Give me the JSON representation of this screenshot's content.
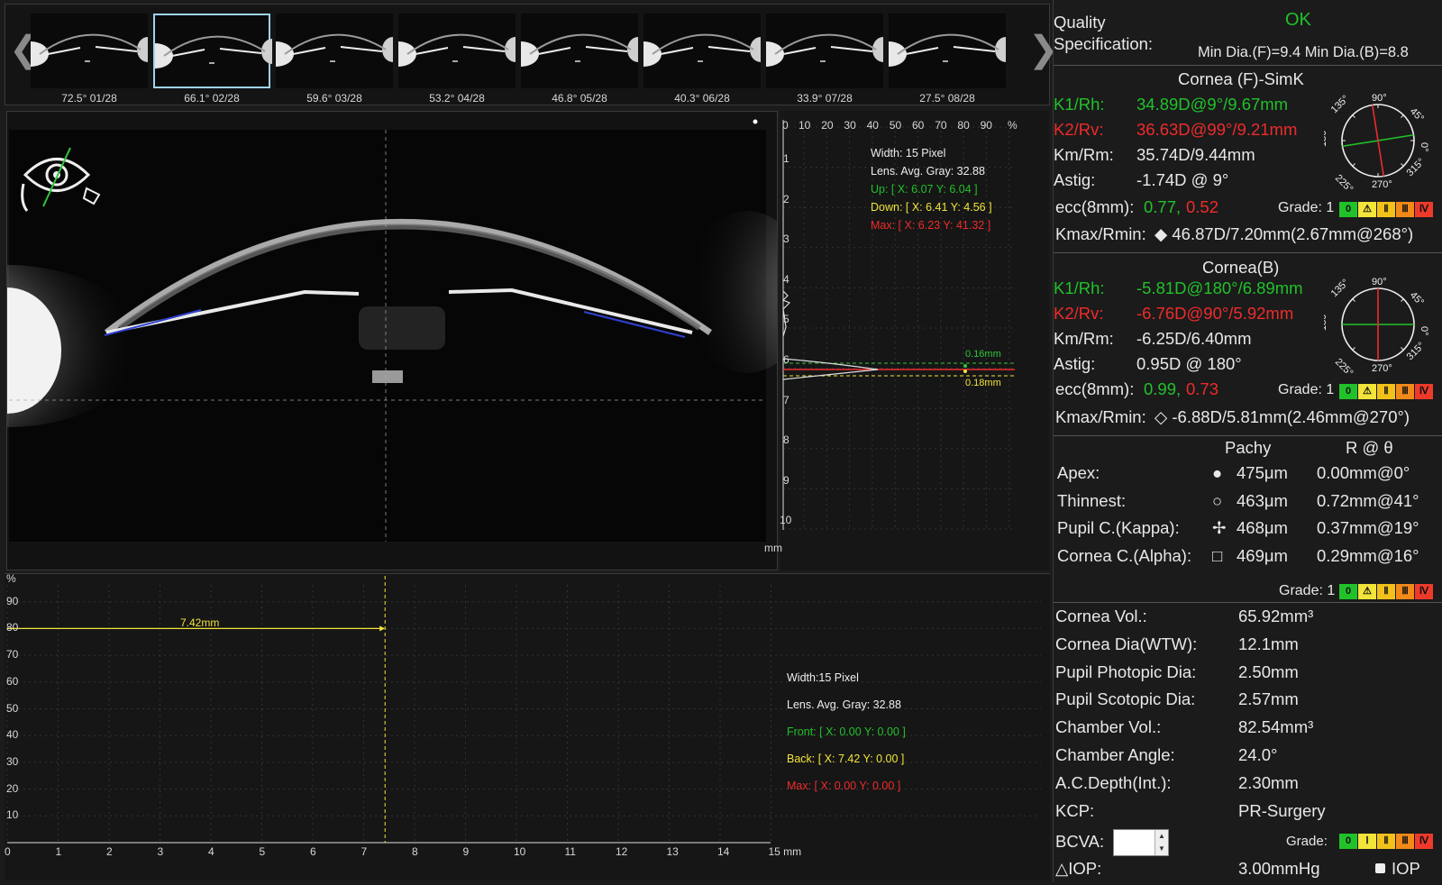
{
  "thumbnails": [
    {
      "angle": "72.5°",
      "index": "01/28"
    },
    {
      "angle": "66.1°",
      "index": "02/28"
    },
    {
      "angle": "59.6°",
      "index": "03/28"
    },
    {
      "angle": "53.2°",
      "index": "04/28"
    },
    {
      "angle": "46.8°",
      "index": "05/28"
    },
    {
      "angle": "40.3°",
      "index": "06/28"
    },
    {
      "angle": "33.9°",
      "index": "07/28"
    },
    {
      "angle": "27.5°",
      "index": "08/28"
    }
  ],
  "nav": {
    "prev": "❮",
    "next": "❯"
  },
  "profile": {
    "x_ticks": [
      "0",
      "10",
      "20",
      "30",
      "40",
      "50",
      "60",
      "70",
      "80",
      "90",
      "%"
    ],
    "y_ticks": [
      "1",
      "2",
      "3",
      "4",
      "5",
      "6",
      "7",
      "8",
      "9",
      "10"
    ],
    "y_unit": "mm",
    "width": "Width: 15 Pixel",
    "avg_gray": "Lens. Avg. Gray: 32.88",
    "up": "Up: [ X: 6.07  Y: 6.04 ]",
    "down": "Down: [ X: 6.41  Y: 4.56 ]",
    "max": "Max: [ X: 6.23  Y: 41.32 ]",
    "label_top": "0.16mm",
    "label_bottom": "0.18mm"
  },
  "graph": {
    "y_unit": "%",
    "y_ticks": [
      "90",
      "80",
      "70",
      "60",
      "50",
      "40",
      "30",
      "20",
      "10"
    ],
    "x_ticks": [
      "0",
      "1",
      "2",
      "3",
      "4",
      "5",
      "6",
      "7",
      "8",
      "9",
      "10",
      "11",
      "12",
      "13",
      "14",
      "15 mm"
    ],
    "measure": "7.42mm",
    "width": "Width:15 Pixel",
    "avg_gray": "Lens. Avg. Gray: 32.88",
    "front": "Front: [ X: 0.00  Y: 0.00 ]",
    "back": "Back: [ X: 7.42  Y: 0.00 ]",
    "max": "Max: [ X: 0.00  Y: 0.00 ]"
  },
  "quality": {
    "label_line1": "Quality",
    "label_line2": "Specification:",
    "status": "OK",
    "min_dia": "Min Dia.(F)=9.4   Min Dia.(B)=8.8"
  },
  "cornea_front": {
    "title": "Cornea (F)-SimK",
    "k1_label": "K1/Rh:",
    "k1_value": "34.89D@9°/9.67mm",
    "k2_label": "K2/Rv:",
    "k2_value": "36.63D@99°/9.21mm",
    "km_label": "Km/Rm:",
    "km_value": "35.74D/9.44mm",
    "astig_label": "Astig:",
    "astig_value": "-1.74D @ 9°",
    "ecc_label": "ecc(8mm):",
    "ecc_a": "0.77,",
    "ecc_b": "0.52",
    "grade_label": "Grade: 1",
    "kmax_label": "Kmax/Rmin:",
    "kmax_value": "◆ 46.87D/7.20mm(2.67mm@268°)"
  },
  "cornea_back": {
    "title": "Cornea(B)",
    "k1_label": "K1/Rh:",
    "k1_value": "-5.81D@180°/6.89mm",
    "k2_label": "K2/Rv:",
    "k2_value": "-6.76D@90°/5.92mm",
    "km_label": "Km/Rm:",
    "km_value": "-6.25D/6.40mm",
    "astig_label": "Astig:",
    "astig_value": "0.95D @ 180°",
    "ecc_label": "ecc(8mm):",
    "ecc_a": "0.99,",
    "ecc_b": "0.73",
    "grade_label": "Grade: 1",
    "kmax_label": "Kmax/Rmin:",
    "kmax_value": "◇ -6.88D/5.81mm(2.46mm@270°)"
  },
  "dial_labels": {
    "a90": "90°",
    "a45": "45°",
    "a135": "135°",
    "a180": "180°",
    "a0": "0°",
    "a225": "225°",
    "a270": "270°",
    "a315": "315°"
  },
  "pachy": {
    "col_pachy": "Pachy",
    "col_r": "R @ θ",
    "rows": [
      {
        "label": "Apex:",
        "symbol": "●",
        "pachy": "475μm",
        "r": "0.00mm@0°"
      },
      {
        "label": "Thinnest:",
        "symbol": "○",
        "pachy": "463μm",
        "r": "0.72mm@41°"
      },
      {
        "label": "Pupil C.(Kappa):",
        "symbol": "✢",
        "pachy": "468μm",
        "r": "0.37mm@19°"
      },
      {
        "label": "Cornea C.(Alpha):",
        "symbol": "□",
        "pachy": "469μm",
        "r": "0.29mm@16°"
      }
    ],
    "grade_label": "Grade: 1"
  },
  "grade_bar_a": [
    "0",
    "⚠",
    "Ⅱ",
    "Ⅲ",
    "Ⅳ"
  ],
  "grade_bar_b": [
    "0",
    "Ⅰ",
    "Ⅱ",
    "Ⅲ",
    "Ⅳ"
  ],
  "metrics": [
    {
      "label": "Cornea Vol.:",
      "value": "65.92mm³"
    },
    {
      "label": "Cornea Dia(WTW):",
      "value": "12.1mm"
    },
    {
      "label": "Pupil Photopic Dia:",
      "value": "2.50mm"
    },
    {
      "label": "Pupil Scotopic Dia:",
      "value": "2.57mm"
    },
    {
      "label": "Chamber Vol.:",
      "value": "82.54mm³"
    },
    {
      "label": "Chamber Angle:",
      "value": "24.0°"
    },
    {
      "label": "A.C.Depth(Int.):",
      "value": "2.30mm"
    },
    {
      "label": "KCP:",
      "value": "PR-Surgery"
    }
  ],
  "bcva": {
    "label": "BCVA:",
    "value": "",
    "grade_label": "Grade:"
  },
  "iop": {
    "label": "△IOP:",
    "value": "3.00mmHg",
    "checkbox_label": "IOP"
  },
  "colors": {
    "green": "#21c12a",
    "red": "#ef2b2b",
    "yellow": "#f2e43a",
    "orange": "#f28a1a"
  }
}
